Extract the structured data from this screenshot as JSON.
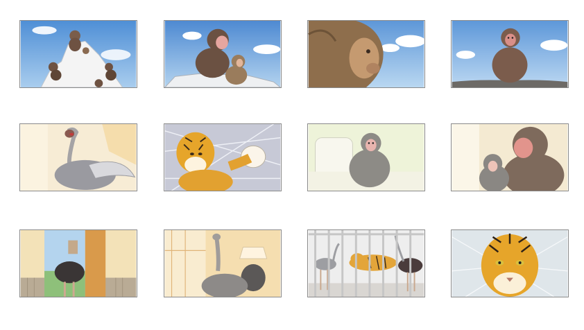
{
  "storyboard": {
    "panels": [
      {
        "scene": "monkeys-on-snowy-rock",
        "colors": {
          "sky": "#6fa8dc",
          "snow": "#f2f2f2",
          "fur": "#7a5d4a"
        }
      },
      {
        "scene": "monkey-with-baby-on-rock",
        "colors": {
          "sky": "#6fa8dc",
          "fur": "#6b5142"
        }
      },
      {
        "scene": "monkey-closeup-profile",
        "colors": {
          "sky": "#8ab8e6",
          "fur": "#9a7a55"
        }
      },
      {
        "scene": "monkey-sitting-on-rock",
        "colors": {
          "sky": "#7fb2e0",
          "fur": "#7b5c4c"
        }
      },
      {
        "scene": "ostrich-flapping-wings",
        "colors": {
          "bg": "#f7ecd5",
          "feathers": "#9a9aa0"
        }
      },
      {
        "scene": "tiger-punching",
        "colors": {
          "bg": "#c7c9d6",
          "fur": "#e6a52a"
        }
      },
      {
        "scene": "monkey-sitting-on-sofa",
        "colors": {
          "bg": "#eef3d9",
          "fur": "#8d8b86"
        }
      },
      {
        "scene": "monkey-and-baby-indoors",
        "colors": {
          "bg": "#f4ead2",
          "fur": "#7e6a5c"
        }
      },
      {
        "scene": "ostrich-in-doorway",
        "colors": {
          "bg": "#f3e2b8",
          "feathers": "#3a3535"
        }
      },
      {
        "scene": "ostrich-looking-back",
        "colors": {
          "bg": "#f5deb0",
          "feathers": "#8d8a88"
        }
      },
      {
        "scene": "tiger-and-ostriches-in-cage",
        "colors": {
          "bg": "#eeeeee",
          "fur": "#e3a53a"
        }
      },
      {
        "scene": "tiger-face-closeup",
        "colors": {
          "bg": "#dfe6ea",
          "fur": "#e6a52a"
        }
      }
    ]
  }
}
